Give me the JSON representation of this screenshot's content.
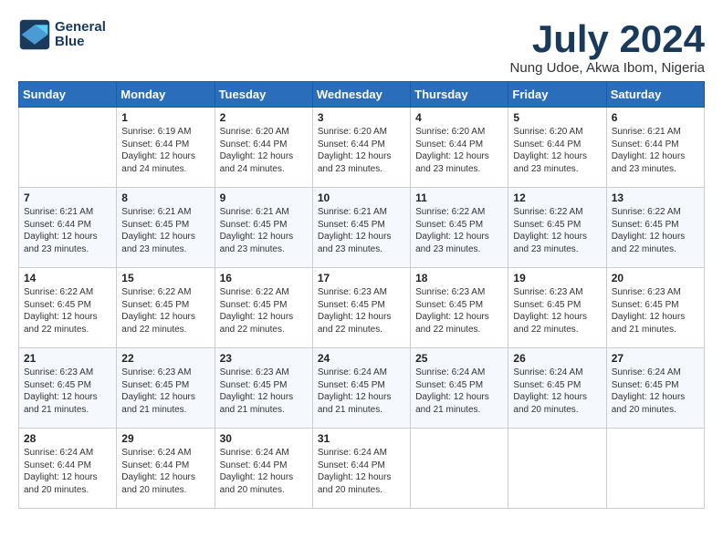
{
  "header": {
    "logo_line1": "General",
    "logo_line2": "Blue",
    "month": "July 2024",
    "location": "Nung Udoe, Akwa Ibom, Nigeria"
  },
  "weekdays": [
    "Sunday",
    "Monday",
    "Tuesday",
    "Wednesday",
    "Thursday",
    "Friday",
    "Saturday"
  ],
  "weeks": [
    [
      {
        "day": "",
        "info": ""
      },
      {
        "day": "1",
        "info": "Sunrise: 6:19 AM\nSunset: 6:44 PM\nDaylight: 12 hours\nand 24 minutes."
      },
      {
        "day": "2",
        "info": "Sunrise: 6:20 AM\nSunset: 6:44 PM\nDaylight: 12 hours\nand 24 minutes."
      },
      {
        "day": "3",
        "info": "Sunrise: 6:20 AM\nSunset: 6:44 PM\nDaylight: 12 hours\nand 23 minutes."
      },
      {
        "day": "4",
        "info": "Sunrise: 6:20 AM\nSunset: 6:44 PM\nDaylight: 12 hours\nand 23 minutes."
      },
      {
        "day": "5",
        "info": "Sunrise: 6:20 AM\nSunset: 6:44 PM\nDaylight: 12 hours\nand 23 minutes."
      },
      {
        "day": "6",
        "info": "Sunrise: 6:21 AM\nSunset: 6:44 PM\nDaylight: 12 hours\nand 23 minutes."
      }
    ],
    [
      {
        "day": "7",
        "info": "Sunrise: 6:21 AM\nSunset: 6:44 PM\nDaylight: 12 hours\nand 23 minutes."
      },
      {
        "day": "8",
        "info": "Sunrise: 6:21 AM\nSunset: 6:45 PM\nDaylight: 12 hours\nand 23 minutes."
      },
      {
        "day": "9",
        "info": "Sunrise: 6:21 AM\nSunset: 6:45 PM\nDaylight: 12 hours\nand 23 minutes."
      },
      {
        "day": "10",
        "info": "Sunrise: 6:21 AM\nSunset: 6:45 PM\nDaylight: 12 hours\nand 23 minutes."
      },
      {
        "day": "11",
        "info": "Sunrise: 6:22 AM\nSunset: 6:45 PM\nDaylight: 12 hours\nand 23 minutes."
      },
      {
        "day": "12",
        "info": "Sunrise: 6:22 AM\nSunset: 6:45 PM\nDaylight: 12 hours\nand 23 minutes."
      },
      {
        "day": "13",
        "info": "Sunrise: 6:22 AM\nSunset: 6:45 PM\nDaylight: 12 hours\nand 22 minutes."
      }
    ],
    [
      {
        "day": "14",
        "info": "Sunrise: 6:22 AM\nSunset: 6:45 PM\nDaylight: 12 hours\nand 22 minutes."
      },
      {
        "day": "15",
        "info": "Sunrise: 6:22 AM\nSunset: 6:45 PM\nDaylight: 12 hours\nand 22 minutes."
      },
      {
        "day": "16",
        "info": "Sunrise: 6:22 AM\nSunset: 6:45 PM\nDaylight: 12 hours\nand 22 minutes."
      },
      {
        "day": "17",
        "info": "Sunrise: 6:23 AM\nSunset: 6:45 PM\nDaylight: 12 hours\nand 22 minutes."
      },
      {
        "day": "18",
        "info": "Sunrise: 6:23 AM\nSunset: 6:45 PM\nDaylight: 12 hours\nand 22 minutes."
      },
      {
        "day": "19",
        "info": "Sunrise: 6:23 AM\nSunset: 6:45 PM\nDaylight: 12 hours\nand 22 minutes."
      },
      {
        "day": "20",
        "info": "Sunrise: 6:23 AM\nSunset: 6:45 PM\nDaylight: 12 hours\nand 21 minutes."
      }
    ],
    [
      {
        "day": "21",
        "info": "Sunrise: 6:23 AM\nSunset: 6:45 PM\nDaylight: 12 hours\nand 21 minutes."
      },
      {
        "day": "22",
        "info": "Sunrise: 6:23 AM\nSunset: 6:45 PM\nDaylight: 12 hours\nand 21 minutes."
      },
      {
        "day": "23",
        "info": "Sunrise: 6:23 AM\nSunset: 6:45 PM\nDaylight: 12 hours\nand 21 minutes."
      },
      {
        "day": "24",
        "info": "Sunrise: 6:24 AM\nSunset: 6:45 PM\nDaylight: 12 hours\nand 21 minutes."
      },
      {
        "day": "25",
        "info": "Sunrise: 6:24 AM\nSunset: 6:45 PM\nDaylight: 12 hours\nand 21 minutes."
      },
      {
        "day": "26",
        "info": "Sunrise: 6:24 AM\nSunset: 6:45 PM\nDaylight: 12 hours\nand 20 minutes."
      },
      {
        "day": "27",
        "info": "Sunrise: 6:24 AM\nSunset: 6:45 PM\nDaylight: 12 hours\nand 20 minutes."
      }
    ],
    [
      {
        "day": "28",
        "info": "Sunrise: 6:24 AM\nSunset: 6:44 PM\nDaylight: 12 hours\nand 20 minutes."
      },
      {
        "day": "29",
        "info": "Sunrise: 6:24 AM\nSunset: 6:44 PM\nDaylight: 12 hours\nand 20 minutes."
      },
      {
        "day": "30",
        "info": "Sunrise: 6:24 AM\nSunset: 6:44 PM\nDaylight: 12 hours\nand 20 minutes."
      },
      {
        "day": "31",
        "info": "Sunrise: 6:24 AM\nSunset: 6:44 PM\nDaylight: 12 hours\nand 20 minutes."
      },
      {
        "day": "",
        "info": ""
      },
      {
        "day": "",
        "info": ""
      },
      {
        "day": "",
        "info": ""
      }
    ]
  ]
}
